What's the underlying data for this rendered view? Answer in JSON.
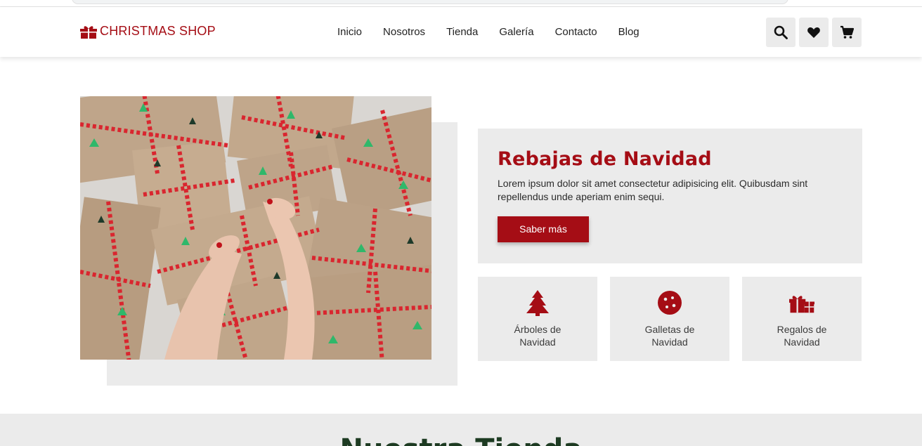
{
  "header": {
    "logo_text": "CHRISTMAS SHOP",
    "nav": [
      "Inicio",
      "Nosotros",
      "Tienda",
      "Galería",
      "Contacto",
      "Blog"
    ],
    "actions": [
      "search-icon",
      "heart-icon",
      "cart-icon"
    ]
  },
  "promo": {
    "title": "Rebajas de Navidad",
    "text": "Lorem ipsum dolor sit amet consectetur adipisicing elit. Quibusdam sint repellendus unde aperiam enim sequi.",
    "button_label": "Saber más"
  },
  "categories": [
    {
      "label": "Árboles de Navidad",
      "icon": "tree-icon"
    },
    {
      "label": "Galletas de Navidad",
      "icon": "cookie-icon"
    },
    {
      "label": "Regalos de Navidad",
      "icon": "gift-icon"
    }
  ],
  "shop": {
    "heading": "Nuestra Tienda"
  },
  "colors": {
    "brand": "#a50d15",
    "panel": "#ebebeb",
    "heading_green": "#1d3b22"
  }
}
